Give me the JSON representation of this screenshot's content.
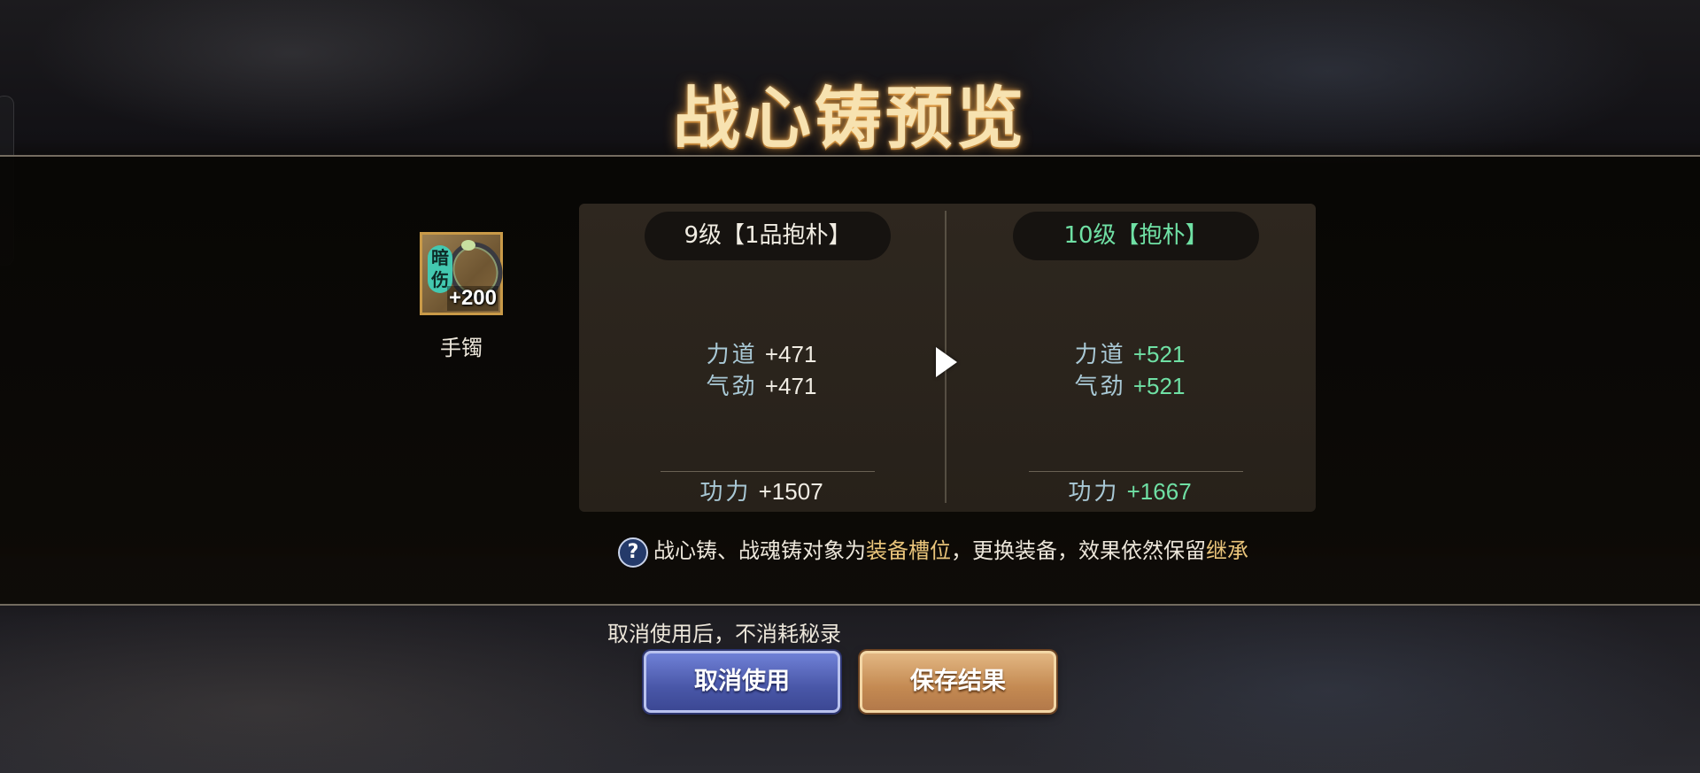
{
  "title": "战心铸预览",
  "item": {
    "tag": "暗伤",
    "level": "+200",
    "name": "手镯",
    "icon": "bracelet-icon"
  },
  "current": {
    "level_label": "9级【1品抱朴】",
    "stats": [
      {
        "label": "力道",
        "value": "+471"
      },
      {
        "label": "气劲",
        "value": "+471"
      }
    ],
    "power_label": "功力",
    "power_value": "+1507"
  },
  "preview": {
    "level_label": "10级【抱朴】",
    "stats": [
      {
        "label": "力道",
        "value": "+521"
      },
      {
        "label": "气劲",
        "value": "+521"
      }
    ],
    "power_label": "功力",
    "power_value": "+1667"
  },
  "help": {
    "icon": "?",
    "text_1": "战心铸、战魂铸对象为",
    "highlight_1": "装备槽位",
    "text_2": "，更换装备，效果依然保留",
    "highlight_2": "继承"
  },
  "cancel_note": "取消使用后，不消耗秘录",
  "buttons": {
    "cancel": "取消使用",
    "save": "保存结果"
  },
  "colors": {
    "title": "#f7e2b0",
    "upgrade_green": "#6fe0a4",
    "highlight_gold": "#e9c47a",
    "cancel_button": "#4957a8",
    "save_button": "#c48a52"
  }
}
